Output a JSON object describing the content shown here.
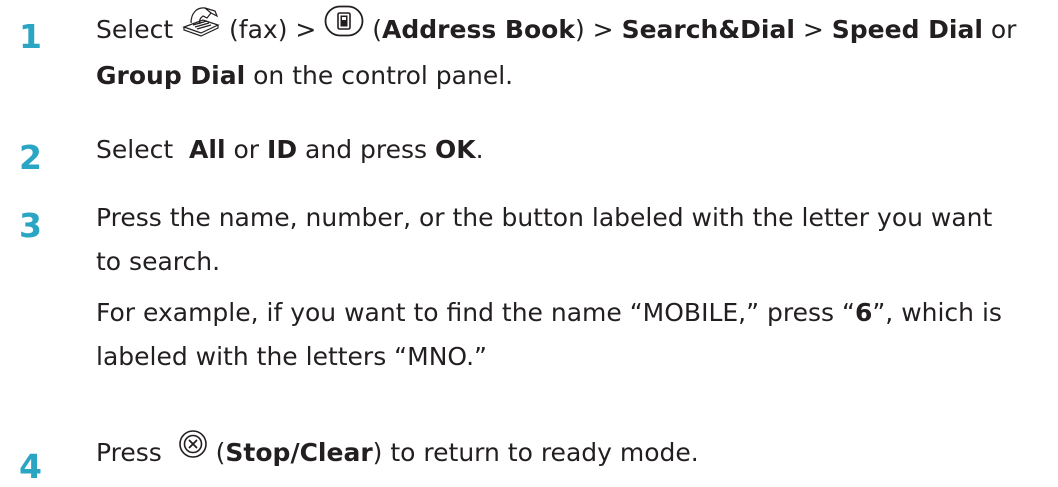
{
  "steps": [
    {
      "number": "1",
      "select": "Select",
      "fax_label": "(fax) >",
      "address_open": "(",
      "address_book": "Address Book",
      "address_close": ") >",
      "search_dial": "Search&Dial",
      "sep": ">",
      "speed_dial": "Speed Dial",
      "or": "or",
      "group_dial": "Group Dial",
      "tail": "on the control panel."
    },
    {
      "number": "2",
      "select": "Select",
      "all": "All",
      "or": "or",
      "id": "ID",
      "and_press": "and press",
      "ok": "OK",
      "period": "."
    },
    {
      "number": "3",
      "line1": "Press the name, number, or the button labeled with the letter you want",
      "line2": "to search.",
      "example_pre": "For example, if you want to find the name “MOBILE,” press “",
      "example_key": "6",
      "example_post": "”, which is",
      "example_line2": "labeled with the letters “MNO.”"
    },
    {
      "number": "4",
      "press": "Press",
      "open": "(",
      "stop_clear": "Stop/Clear",
      "tail": ") to return to ready mode."
    }
  ],
  "icons": {
    "fax": "fax-icon",
    "address_book": "address-book-button-icon",
    "stop_clear": "stop-clear-button-icon"
  },
  "colors": {
    "step_number": "#2aa5c4",
    "text": "#231f20"
  }
}
